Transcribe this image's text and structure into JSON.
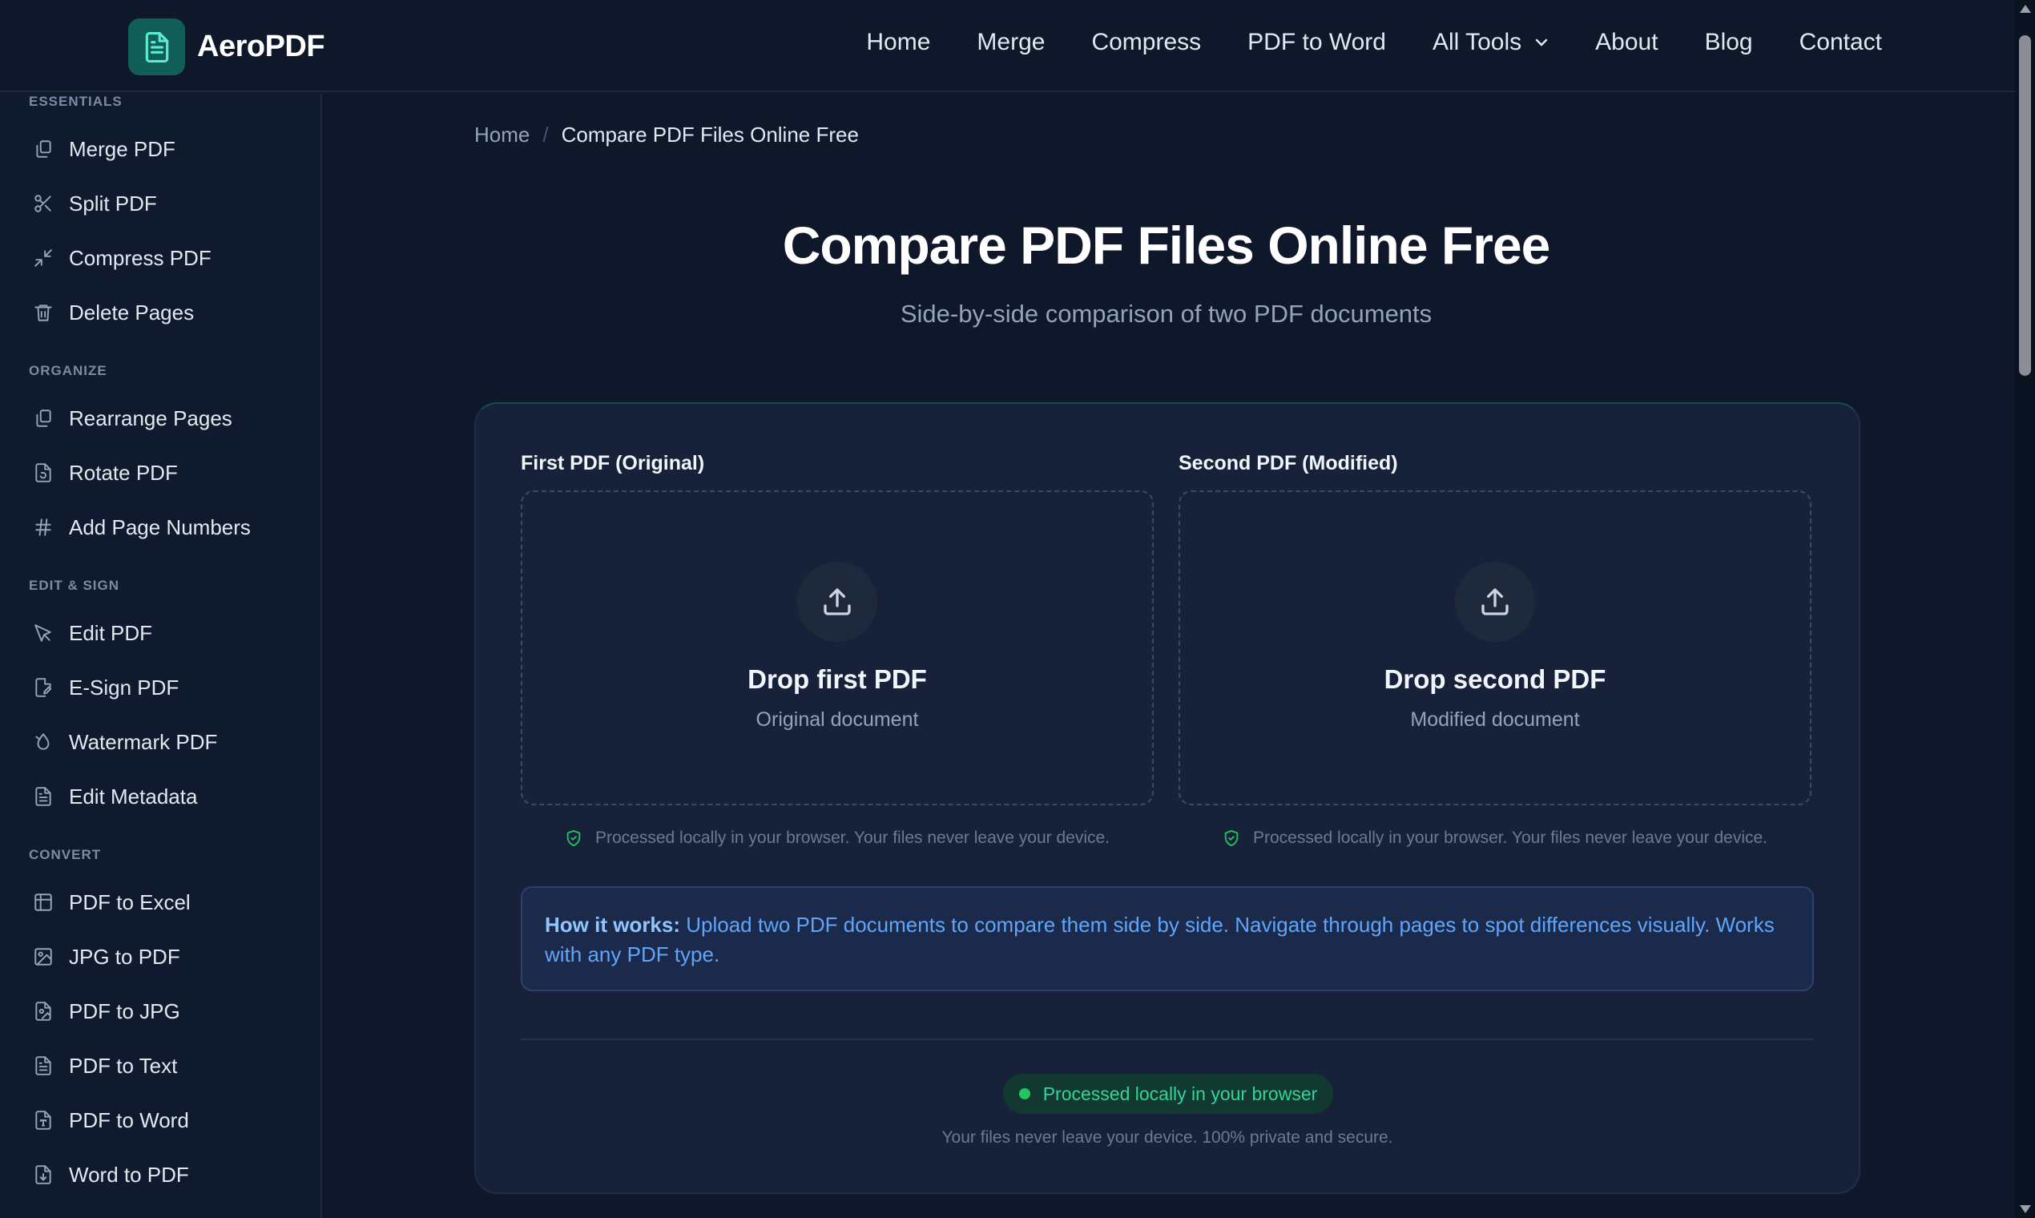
{
  "app": {
    "name": "AeroPDF"
  },
  "nav": {
    "items": [
      "Home",
      "Merge",
      "Compress",
      "PDF to Word",
      "All Tools",
      "About",
      "Blog",
      "Contact"
    ]
  },
  "sidebar": {
    "sections": [
      {
        "title": "ESSENTIALS",
        "items": [
          "Merge PDF",
          "Split PDF",
          "Compress PDF",
          "Delete Pages"
        ]
      },
      {
        "title": "ORGANIZE",
        "items": [
          "Rearrange Pages",
          "Rotate PDF",
          "Add Page Numbers"
        ]
      },
      {
        "title": "EDIT & SIGN",
        "items": [
          "Edit PDF",
          "E-Sign PDF",
          "Watermark PDF",
          "Edit Metadata"
        ]
      },
      {
        "title": "CONVERT",
        "items": [
          "PDF to Excel",
          "JPG to PDF",
          "PDF to JPG",
          "PDF to Text",
          "PDF to Word",
          "Word to PDF"
        ]
      }
    ]
  },
  "breadcrumb": {
    "home": "Home",
    "separator": "/",
    "current": "Compare PDF Files Online Free"
  },
  "page": {
    "title": "Compare PDF Files Online Free",
    "subtitle": "Side-by-side comparison of two PDF documents"
  },
  "upload": {
    "first": {
      "label": "First PDF (Original)",
      "title": "Drop first PDF",
      "subtitle": "Original document"
    },
    "second": {
      "label": "Second PDF (Modified)",
      "title": "Drop second PDF",
      "subtitle": "Modified document"
    },
    "privacy_note": "Processed locally in your browser. Your files never leave your device."
  },
  "how_it_works": {
    "label": "How it works:",
    "text": " Upload two PDF documents to compare them side by side. Navigate through pages to spot differences visually. Works with any PDF type."
  },
  "status": {
    "pill": "Processed locally in your browser",
    "note": "Your files never leave your device. 100% private and secure."
  },
  "colors": {
    "background": "#0f172a",
    "accent_teal": "#115e59",
    "status_green": "#22c55e",
    "info_blue": "#60a5fa"
  }
}
